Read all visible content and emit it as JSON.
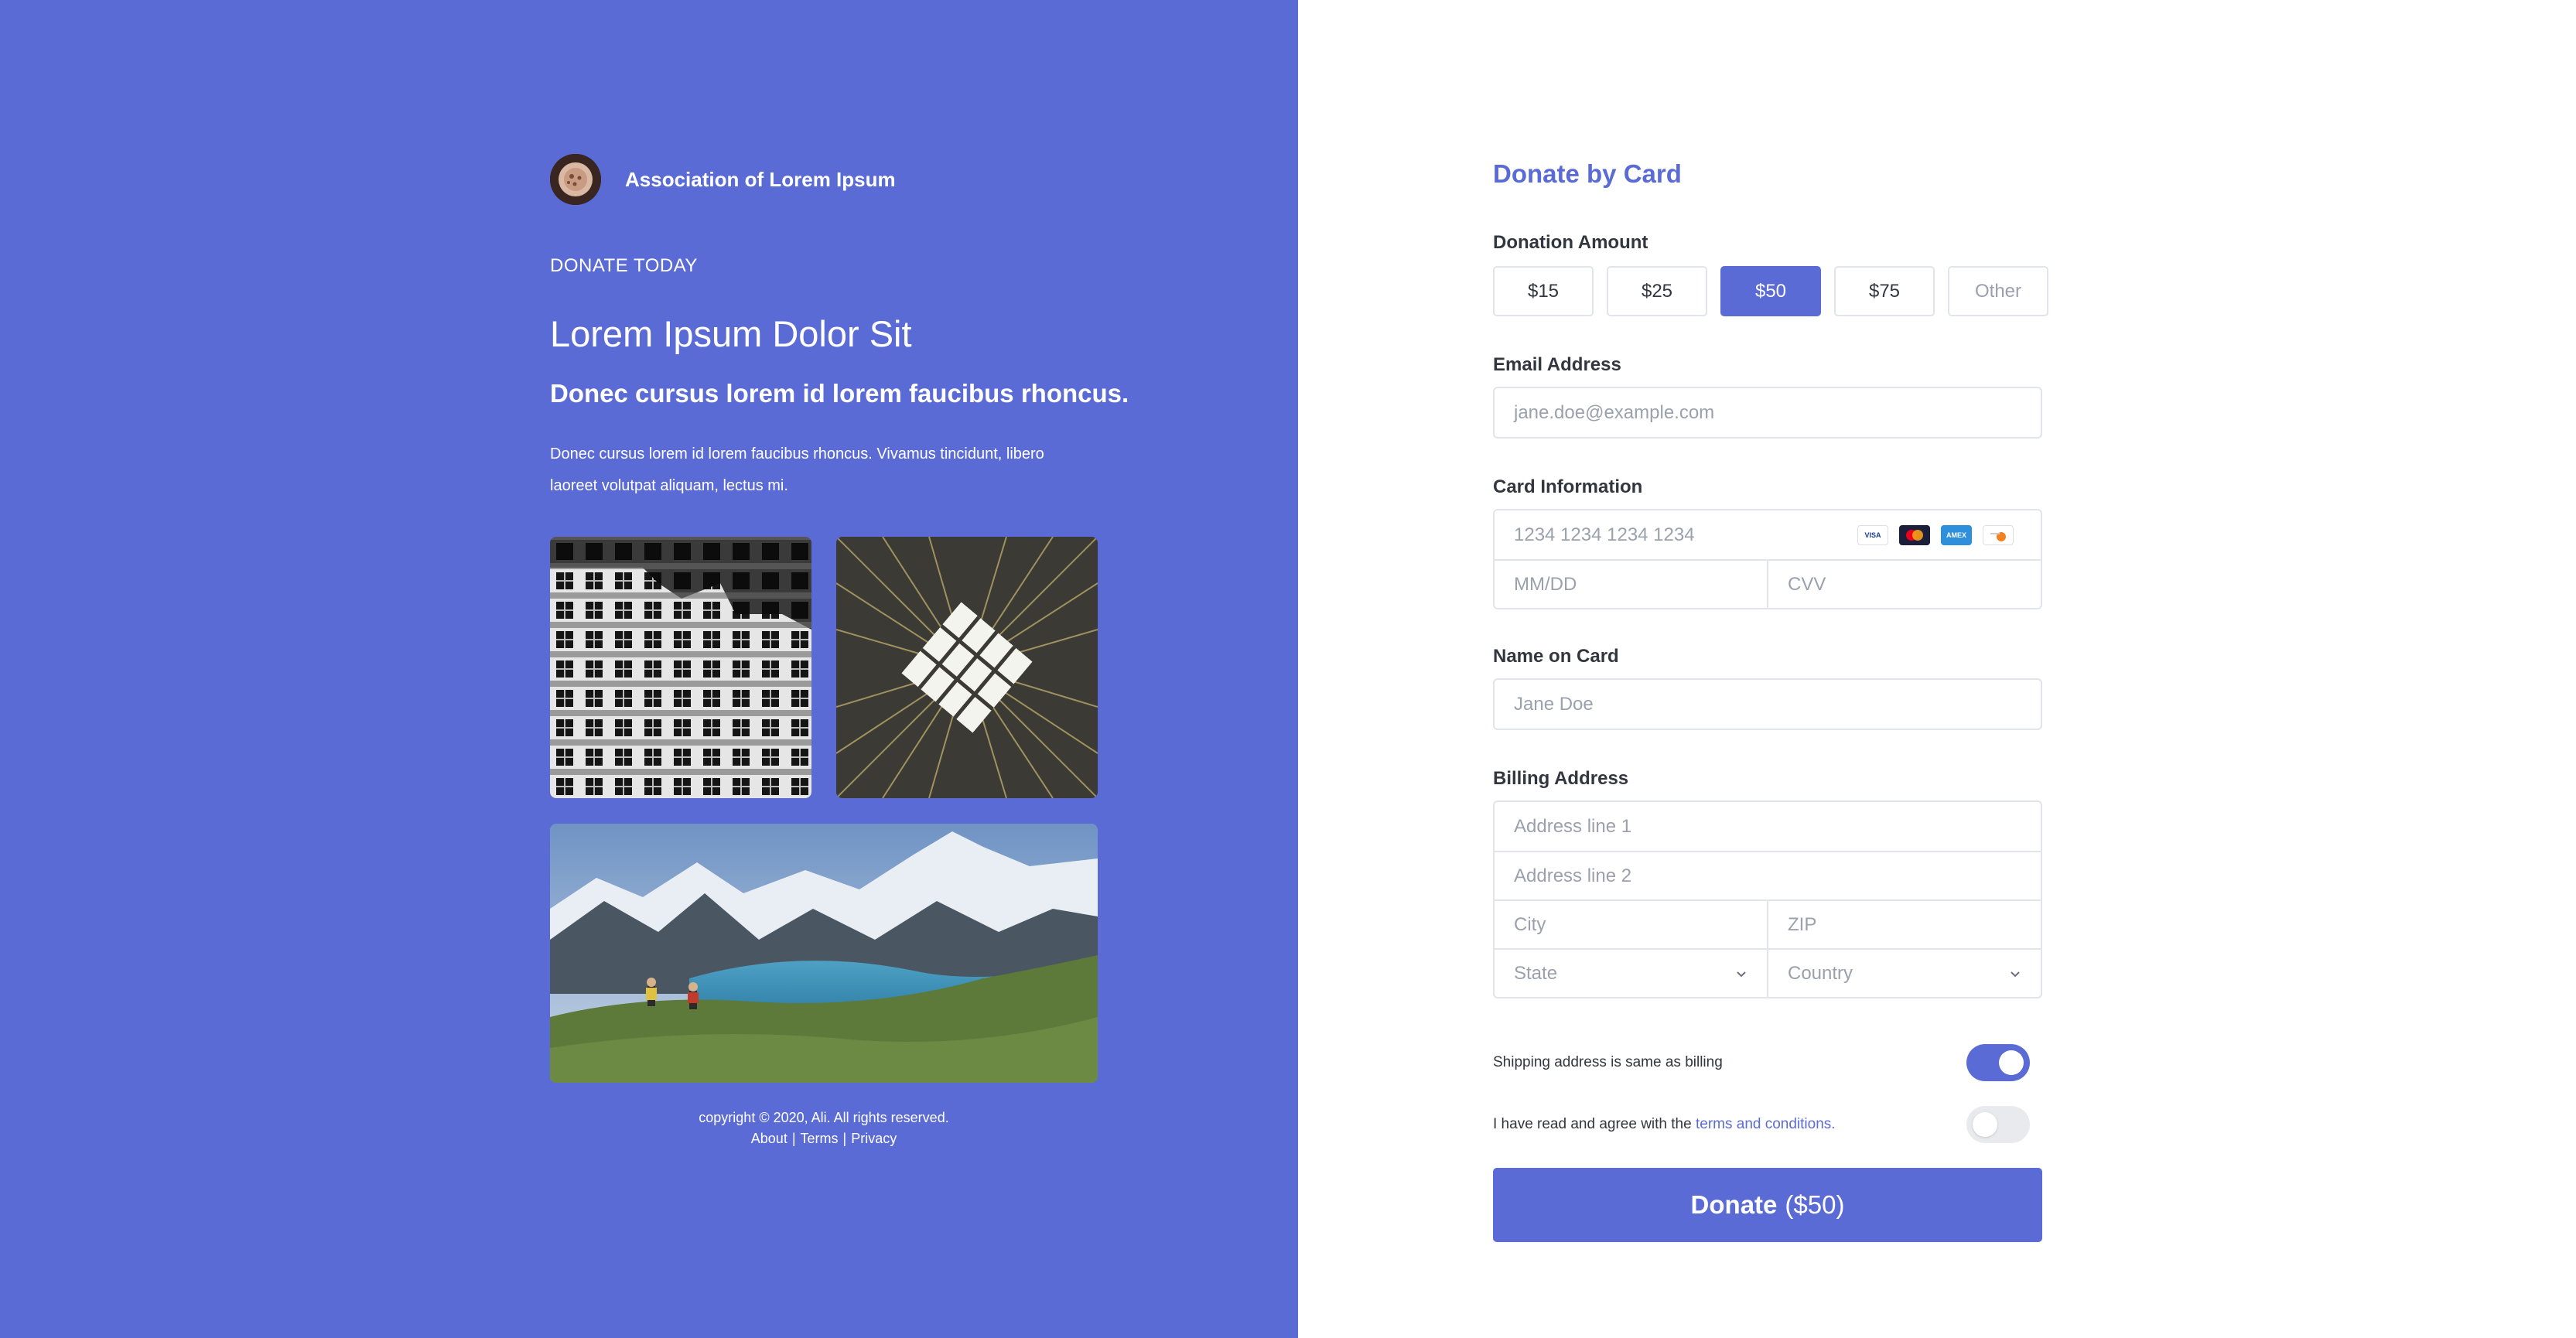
{
  "organization": {
    "name": "Association of Lorem Ipsum"
  },
  "hero": {
    "eyebrow": "DONATE TODAY",
    "title": "Lorem Ipsum Dolor Sit",
    "subtitle": "Donec cursus lorem id lorem faucibus rhoncus.",
    "body": "Donec cursus lorem id lorem faucibus rhoncus. Vivamus tincidunt, libero laoreet volutpat aliquam, lectus mi."
  },
  "footer": {
    "copyright": "copyright © 2020, Ali. All rights reserved.",
    "links": [
      "About",
      "Terms",
      "Privacy"
    ],
    "separator": "|"
  },
  "form": {
    "title": "Donate by Card",
    "donation_amount": {
      "label": "Donation Amount",
      "options": [
        "$15",
        "$25",
        "$50",
        "$75",
        "Other"
      ],
      "selected": "$50"
    },
    "email": {
      "label": "Email Address",
      "placeholder": "jane.doe@example.com"
    },
    "card": {
      "label": "Card Information",
      "number_placeholder": "1234 1234 1234 1234",
      "expiry_placeholder": "MM/DD",
      "cvv_placeholder": "CVV",
      "brands": [
        "VISA",
        "MC",
        "AMEX",
        "DISC"
      ]
    },
    "name": {
      "label": "Name on Card",
      "placeholder": "Jane Doe"
    },
    "billing": {
      "label": "Billing Address",
      "line1_placeholder": "Address line 1",
      "line2_placeholder": "Address line 2",
      "city_placeholder": "City",
      "zip_placeholder": "ZIP",
      "state_placeholder": "State",
      "country_placeholder": "Country"
    },
    "shipping_toggle": {
      "label": "Shipping address is same as billing",
      "on": true
    },
    "terms_toggle": {
      "label_prefix": "I have read and agree with the ",
      "link": "terms and conditions.",
      "on": false
    },
    "submit": {
      "label": "Donate",
      "amount": "($50)"
    }
  },
  "colors": {
    "accent": "#5b6bd5",
    "text": "#32363e",
    "placeholder": "#9aa1ac",
    "border": "#e1e4ea"
  }
}
